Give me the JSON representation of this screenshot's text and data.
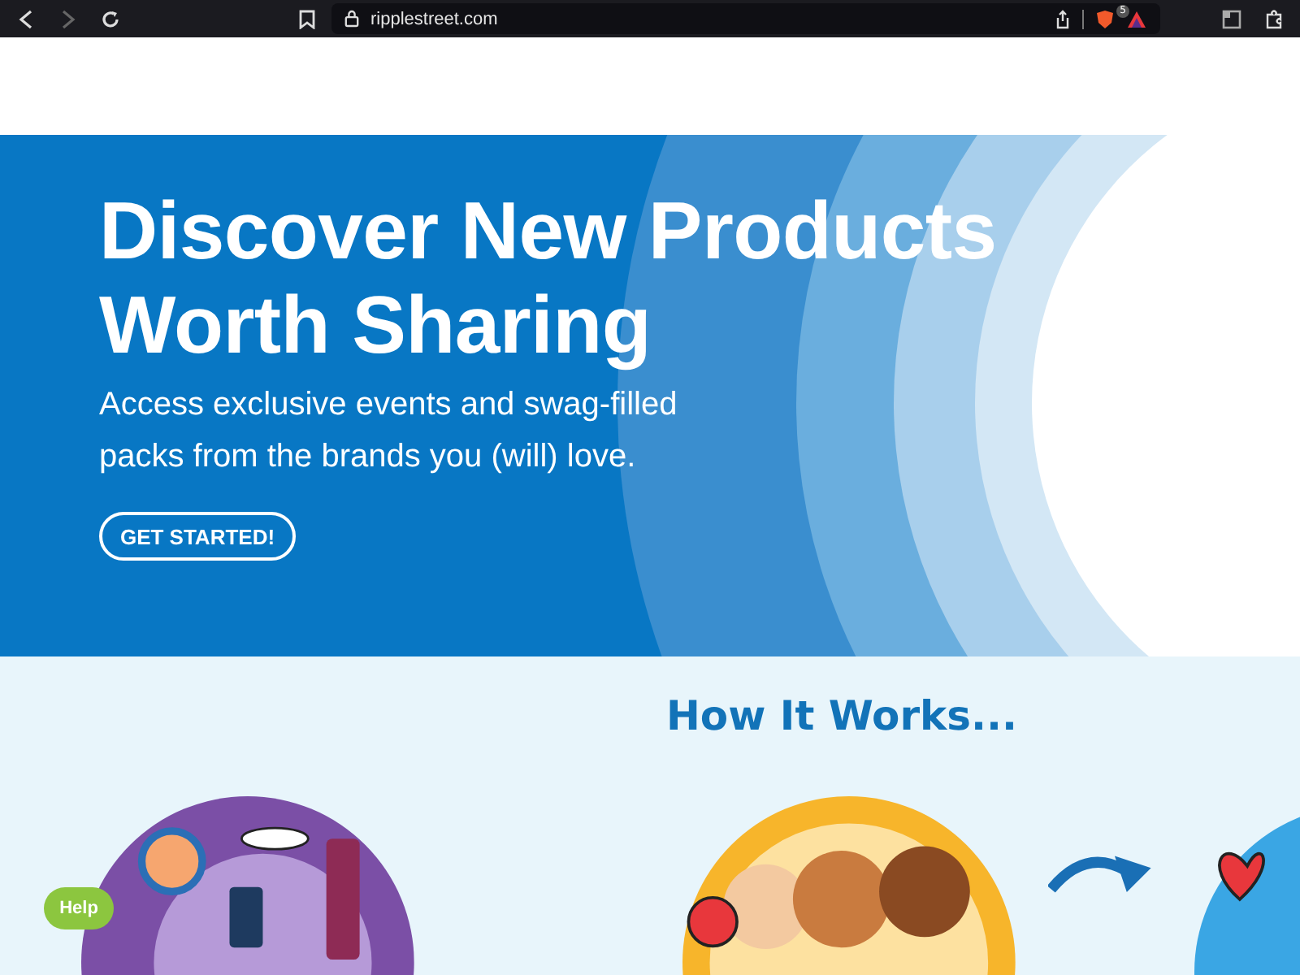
{
  "browser": {
    "url": "ripplestreet.com",
    "extension_badge": "5"
  },
  "hero": {
    "title_lines": [
      "Discover New Products",
      "Worth Sharing"
    ],
    "subtitle_lines": [
      "Access exclusive events and swag-filled",
      "packs from the brands you (will) love."
    ],
    "cta": "GET STARTED!"
  },
  "how_it_works": {
    "heading": "How It Works..."
  },
  "help_button": "Help"
}
